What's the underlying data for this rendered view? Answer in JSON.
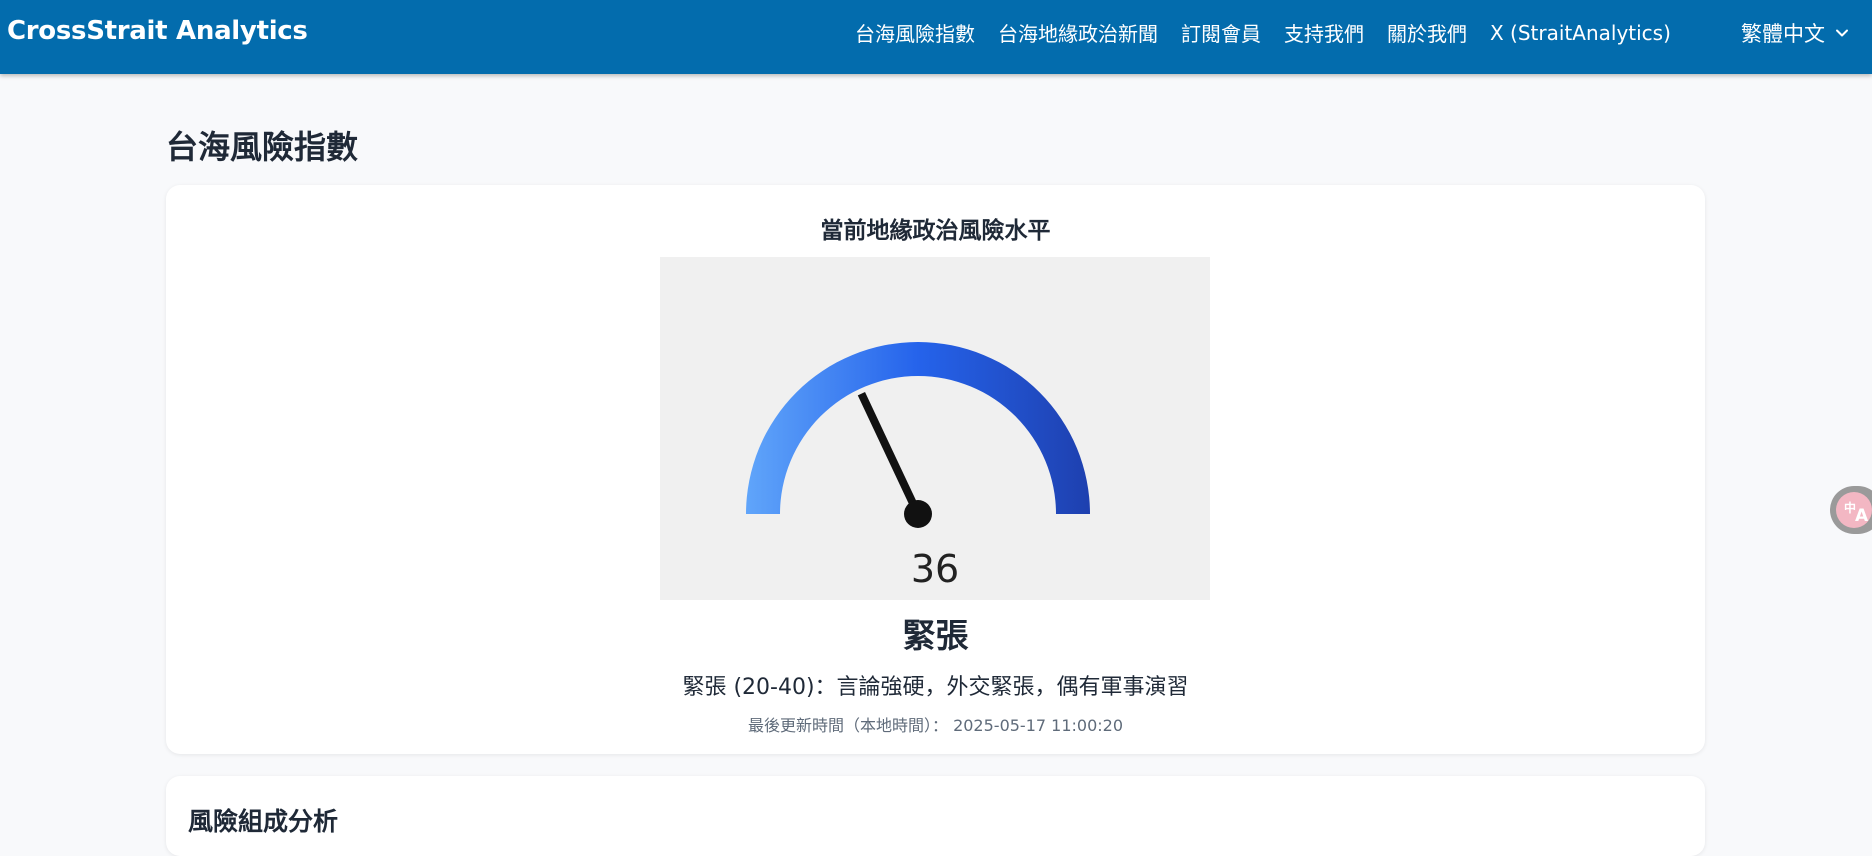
{
  "navbar": {
    "brand": "CrossStrait Analytics",
    "links": [
      {
        "label": "台海風險指數"
      },
      {
        "label": "台海地緣政治新聞"
      },
      {
        "label": "訂閱會員"
      },
      {
        "label": "支持我們"
      },
      {
        "label": "關於我們"
      },
      {
        "label": "X (StraitAnalytics)"
      }
    ],
    "language": "繁體中文",
    "colors": {
      "background": "#036cad",
      "text": "#ffffff"
    }
  },
  "page": {
    "title": "台海風險指數"
  },
  "risk_card": {
    "heading": "當前地緣政治風險水平",
    "gauge": {
      "value": "36",
      "min": 0,
      "max": 100,
      "colors": {
        "start": "#60a5fa",
        "mid": "#2563eb",
        "end": "#1e40af",
        "needle": "#111111"
      }
    },
    "level_label": "緊張",
    "level_description": "緊張 (20-40)：言論強硬，外交緊張，偶有軍事演習",
    "last_updated": "最後更新時間（本地時間）： 2025-05-17 11:00:20"
  },
  "breakdown_card": {
    "title": "風險組成分析"
  },
  "icons": {
    "language_chevron": "chevron-down-icon",
    "translate_fab": "translate-icon"
  }
}
